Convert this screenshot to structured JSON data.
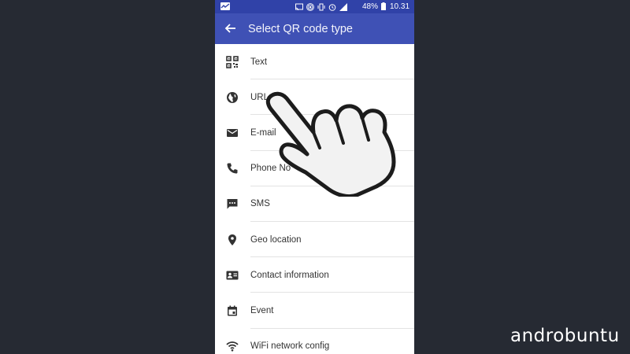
{
  "status_bar": {
    "battery": "48%",
    "time": "10.31",
    "icons": [
      "cast-icon",
      "hotspot-icon",
      "vibrate-icon",
      "alarm-icon",
      "signal-4g-icon",
      "battery-icon"
    ]
  },
  "toolbar": {
    "title": "Select QR code type",
    "back_icon": "arrow-back-icon"
  },
  "list": {
    "items": [
      {
        "label": "Text",
        "icon": "qr-code-icon"
      },
      {
        "label": "URL",
        "icon": "globe-icon"
      },
      {
        "label": "E-mail",
        "icon": "email-icon"
      },
      {
        "label": "Phone No",
        "icon": "phone-icon"
      },
      {
        "label": "SMS",
        "icon": "sms-icon"
      },
      {
        "label": "Geo location",
        "icon": "location-pin-icon"
      },
      {
        "label": "Contact information",
        "icon": "contact-card-icon"
      },
      {
        "label": "Event",
        "icon": "calendar-icon"
      },
      {
        "label": "WiFi network config",
        "icon": "wifi-icon"
      }
    ]
  },
  "watermark": "androbuntu",
  "colors": {
    "background": "#262a33",
    "status_bar": "#3042a8",
    "toolbar": "#3f51b5",
    "text": "#333333"
  }
}
